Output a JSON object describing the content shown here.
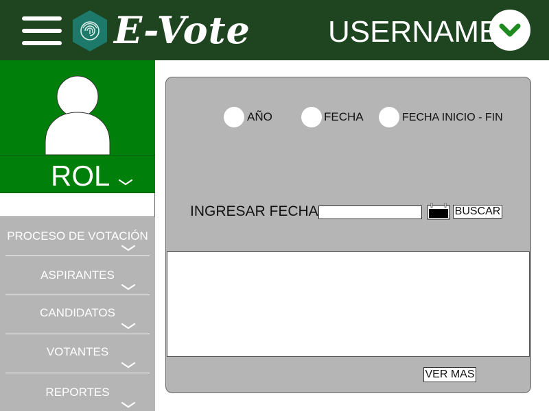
{
  "header": {
    "brand": "E-Vote",
    "username": "USERNAME"
  },
  "sidebar": {
    "rol": "ROL",
    "items": [
      {
        "label": "PROCESO DE VOTACIÓN"
      },
      {
        "label": "ASPIRANTES"
      },
      {
        "label": "CANDIDATOS"
      },
      {
        "label": "VOTANTES"
      },
      {
        "label": "REPORTES"
      }
    ]
  },
  "filters": {
    "options": [
      {
        "label": "AÑO"
      },
      {
        "label": "FECHA"
      },
      {
        "label": "FECHA INICIO - FIN"
      }
    ],
    "ingresar_label": "INGRESAR FECHA:",
    "date_value": "",
    "search_label": "BUSCAR"
  },
  "results": {
    "ver_mas_label": "VER MAS"
  },
  "colors": {
    "header_bg": "#1e4420",
    "profile_bg": "#00800a",
    "panel_bg": "#b5b5b5",
    "accent_green": "#1f8a1f"
  },
  "icons": [
    "menu-icon",
    "fingerprint-logo",
    "chevron-down-icon",
    "user-avatar",
    "calendar-icon"
  ]
}
